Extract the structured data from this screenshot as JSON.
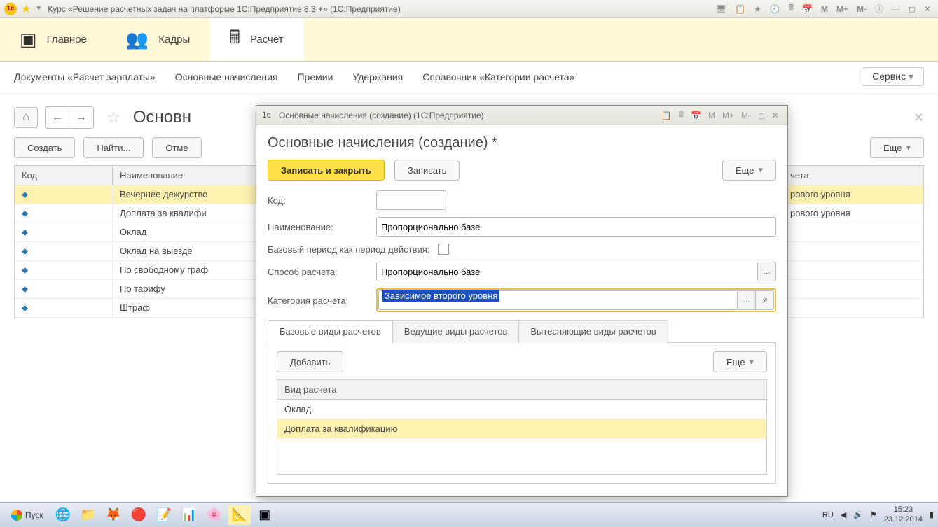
{
  "titlebar": {
    "title": "Курс «Решение расчетных задач на платформе 1С:Предприятие 8.3 +»  (1С:Предприятие)",
    "m_buttons": [
      "M",
      "M+",
      "M-"
    ]
  },
  "main_nav": {
    "items": [
      {
        "label": "Главное",
        "icon": "⚙"
      },
      {
        "label": "Кадры",
        "icon": "👥"
      },
      {
        "label": "Расчет",
        "icon": "🖩"
      }
    ]
  },
  "sub_nav": {
    "items": [
      "Документы «Расчет зарплаты»",
      "Основные начисления",
      "Премии",
      "Удержания",
      "Справочник «Категории расчета»"
    ],
    "service": "Сервис"
  },
  "page": {
    "title": "Основн",
    "create": "Создать",
    "find": "Найти...",
    "cancel": "Отме",
    "more": "Еще"
  },
  "grid": {
    "headers": {
      "code": "Код",
      "name": "Наименование",
      "cat": "чета"
    },
    "rows": [
      {
        "name": "Вечернее дежурство",
        "cat": "рового уровня",
        "sel": true
      },
      {
        "name": "Доплата за квалифи",
        "cat": "рового уровня"
      },
      {
        "name": "Оклад"
      },
      {
        "name": "Оклад на выезде"
      },
      {
        "name": "По свободному граф"
      },
      {
        "name": "По тарифу"
      },
      {
        "name": "Штраф"
      }
    ]
  },
  "dialog": {
    "title": "Основные начисления (создание)  (1С:Предприятие)",
    "heading": "Основные начисления (создание) *",
    "save_close": "Записать и закрыть",
    "save": "Записать",
    "more": "Еще",
    "labels": {
      "code": "Код:",
      "name": "Наименование:",
      "base_period": "Базовый период как период действия:",
      "method": "Способ расчета:",
      "category": "Категория расчета:"
    },
    "values": {
      "code": "",
      "name": "Пропорционально базе",
      "method": "Пропорционально базе",
      "category": "Зависимое второго уровня"
    },
    "tabs": [
      "Базовые виды расчетов",
      "Ведущие виды расчетов",
      "Вытесняющие виды расчетов"
    ],
    "tab_content": {
      "add": "Добавить",
      "more": "Еще",
      "header": "Вид расчета",
      "rows": [
        "Оклад",
        "Доплата за квалификацию"
      ]
    }
  },
  "taskbar": {
    "start": "Пуск",
    "lang": "RU",
    "time": "15:23",
    "date": "23.12.2014"
  }
}
